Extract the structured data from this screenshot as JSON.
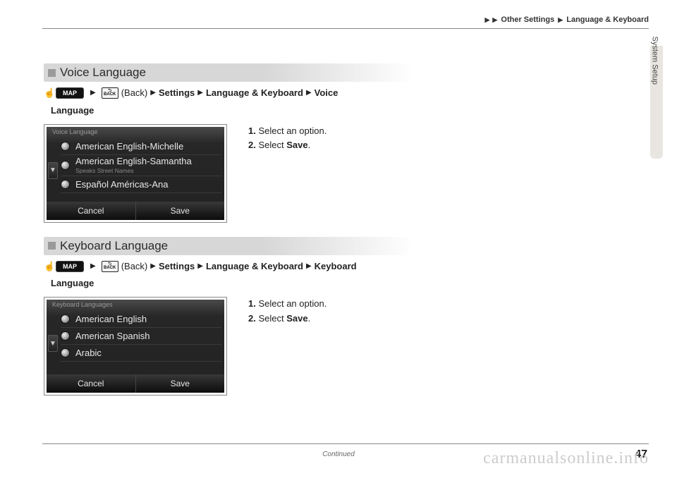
{
  "header": {
    "path1": "Other Settings",
    "path2": "Language & Keyboard"
  },
  "side_tab": "System Setup",
  "section1": {
    "title": "Voice Language",
    "crumb_back_sub": "BACK",
    "crumb_back_label": "(Back)",
    "crumb_settings": "Settings",
    "crumb_lk": "Language & Keyboard",
    "crumb_final": "Voice",
    "crumb_final2": "Language",
    "map_label": "MAP",
    "screenshot": {
      "title": "Voice Language",
      "items": [
        {
          "label": "American English-Michelle",
          "sub": ""
        },
        {
          "label": "American English-Samantha",
          "sub": "Speaks Street Names"
        },
        {
          "label": "Español Américas-Ana",
          "sub": ""
        }
      ],
      "cancel": "Cancel",
      "save": "Save"
    },
    "instructions": {
      "s1_num": "1.",
      "s1_text": " Select an option.",
      "s2_num": "2.",
      "s2_pre": " Select ",
      "s2_bold": "Save",
      "s2_post": "."
    }
  },
  "section2": {
    "title": "Keyboard Language",
    "crumb_back_sub": "BACK",
    "crumb_back_label": "(Back)",
    "crumb_settings": "Settings",
    "crumb_lk": "Language & Keyboard",
    "crumb_final": "Keyboard",
    "crumb_final2": "Language",
    "map_label": "MAP",
    "screenshot": {
      "title": "Keyboard Languages",
      "items": [
        {
          "label": "American English",
          "sub": ""
        },
        {
          "label": "American Spanish",
          "sub": ""
        },
        {
          "label": "Arabic",
          "sub": ""
        }
      ],
      "cancel": "Cancel",
      "save": "Save"
    },
    "instructions": {
      "s1_num": "1.",
      "s1_text": " Select an option.",
      "s2_num": "2.",
      "s2_pre": " Select ",
      "s2_bold": "Save",
      "s2_post": "."
    }
  },
  "footer": {
    "continued": "Continued",
    "page": "47",
    "watermark": "carmanualsonline.info"
  }
}
